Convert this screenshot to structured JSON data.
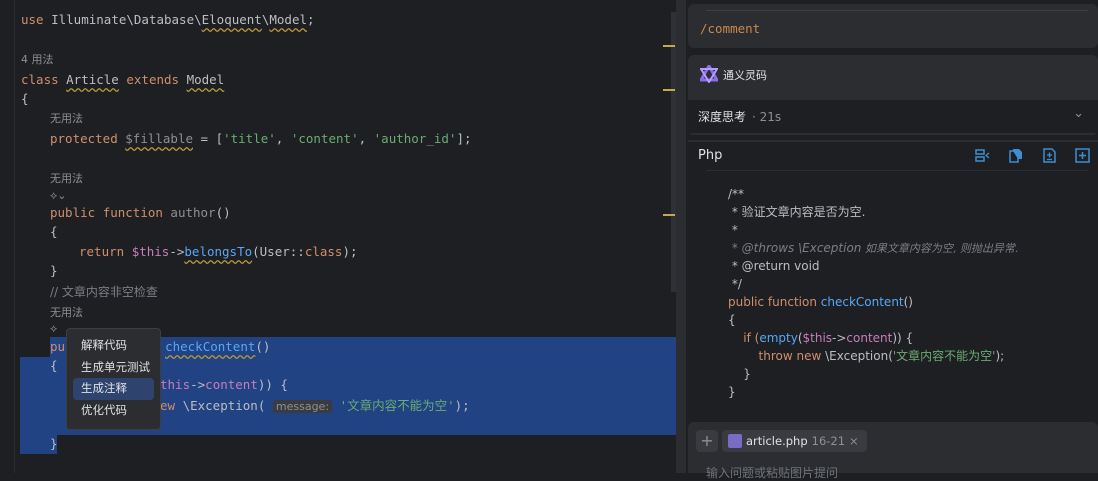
{
  "editor": {
    "lines": {
      "use": [
        "use ",
        "Illuminate\\Database\\",
        "Eloquent",
        "\\",
        "Model",
        ";"
      ],
      "usages4": "4 用法",
      "class": [
        "class ",
        "Article",
        " extends ",
        "Model"
      ],
      "brace_open": "{",
      "unused1": "无用法",
      "fillable": [
        "protected ",
        "$fillable",
        " = [",
        "'title'",
        ", ",
        "'content'",
        ", ",
        "'author_id'",
        "];"
      ],
      "unused2": "无用法",
      "author": [
        "public ",
        "function ",
        "author",
        "()"
      ],
      "brace2": "{",
      "return": [
        "return ",
        "$this",
        "->",
        "belongsTo",
        "(User::",
        "class",
        ");"
      ],
      "brace3": "}",
      "comment": "// 文章内容非空检查",
      "unused3": "无用法",
      "check": [
        "pu",
        "checkContent",
        "()"
      ],
      "brace4": "{",
      "if": [
        "this",
        "->",
        "content",
        ")) {"
      ],
      "throw": [
        "ew ",
        "\\Exception( ",
        "message:",
        " ",
        "'文章内容不能为空'",
        ");"
      ],
      "brace5": "}"
    },
    "context_menu": [
      "解释代码",
      "生成单元测试",
      "生成注释",
      "优化代码"
    ],
    "context_menu_active": 2
  },
  "panel": {
    "command": "/comment",
    "assistant_name": "通义灵码",
    "thinking_label": "深度思考",
    "thinking_time": "· 21s",
    "code_language": "Php",
    "toolbar_icons": [
      "insert-diff-icon",
      "copy-icon",
      "diff-file-icon",
      "new-file-icon"
    ],
    "code": {
      "l1": "/**",
      "l2": " * 验证文章内容是否为空.",
      "l3": " *",
      "l4a": " * @throws \\Exception",
      "l4b": " 如果文章内容为空, 则抛出异常.",
      "l5": " * @return void",
      "l6": " */",
      "l7": [
        "public ",
        "function ",
        "checkContent",
        "()"
      ],
      "l8": "{",
      "l9": [
        "    if (",
        "empty",
        "(",
        "$this",
        "->",
        "content",
        ")) {"
      ],
      "l10": [
        "        throw ",
        "new ",
        "\\Exception(",
        "'文章内容不能为空'",
        ");"
      ],
      "l11": "    }",
      "l12": "}"
    },
    "attachment": {
      "file": "article.php",
      "range": "16-21",
      "close": "×"
    },
    "input_placeholder": "输入问题或粘贴图片提问"
  }
}
